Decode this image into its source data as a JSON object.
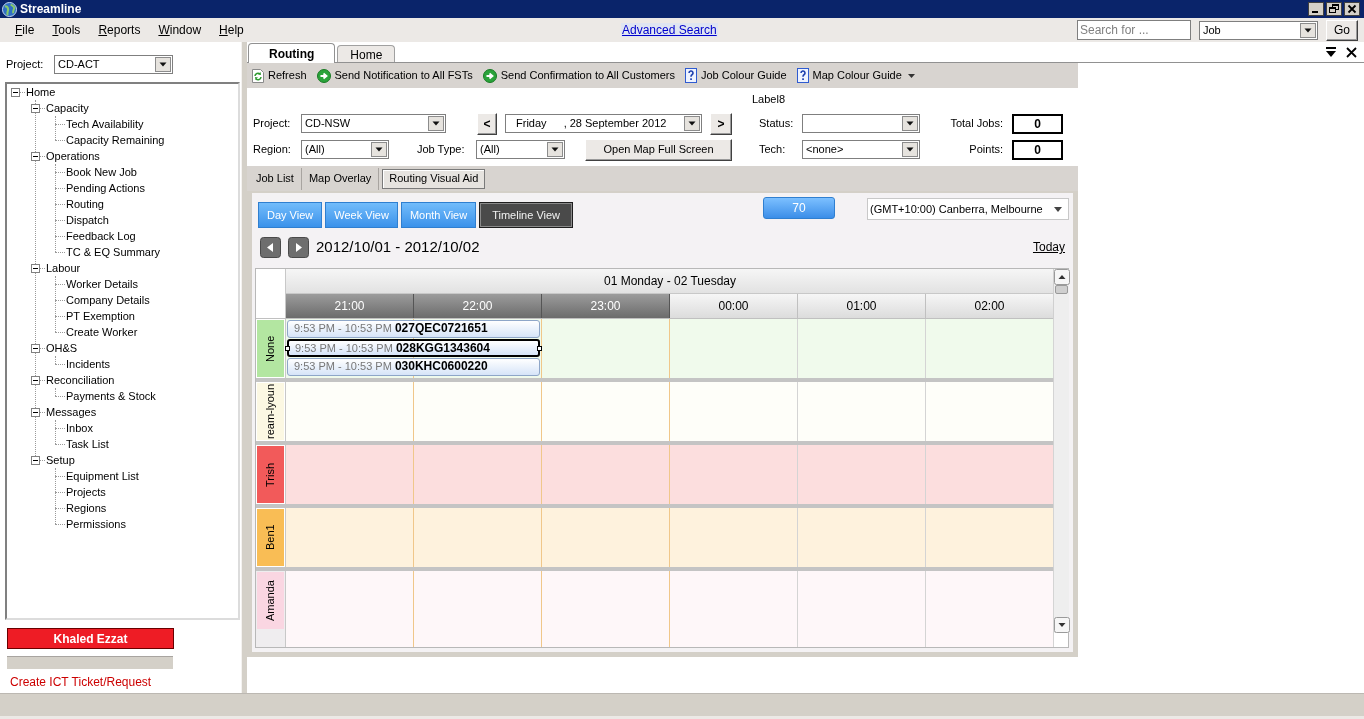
{
  "window": {
    "title": "Streamline"
  },
  "menu": [
    {
      "label": "File"
    },
    {
      "label": "Tools"
    },
    {
      "label": "Reports"
    },
    {
      "label": "Window"
    },
    {
      "label": "Help"
    }
  ],
  "advanced_search": {
    "label": "Advanced Search"
  },
  "quick_search": {
    "placeholder": "Search for ...",
    "type": "Job",
    "button": "Go"
  },
  "sidebar": {
    "project_label": "Project:",
    "project": "CD-ACT",
    "tree": [
      {
        "label": "Home",
        "expanded": true,
        "children": [
          {
            "label": "Capacity",
            "expanded": true,
            "children": [
              {
                "label": "Tech Availability"
              },
              {
                "label": "Capacity Remaining"
              }
            ]
          },
          {
            "label": "Operations",
            "expanded": true,
            "children": [
              {
                "label": "Book New Job"
              },
              {
                "label": "Pending Actions"
              },
              {
                "label": "Routing"
              },
              {
                "label": "Dispatch"
              },
              {
                "label": "Feedback Log"
              },
              {
                "label": "TC & EQ Summary"
              }
            ]
          },
          {
            "label": "Labour",
            "expanded": true,
            "children": [
              {
                "label": "Worker Details"
              },
              {
                "label": "Company Details"
              },
              {
                "label": "PT Exemption"
              },
              {
                "label": "Create Worker"
              }
            ]
          },
          {
            "label": "OH&S",
            "expanded": true,
            "children": [
              {
                "label": "Incidents"
              }
            ]
          },
          {
            "label": "Reconciliation",
            "expanded": true,
            "children": [
              {
                "label": "Payments & Stock"
              }
            ]
          },
          {
            "label": "Messages",
            "expanded": true,
            "children": [
              {
                "label": "Inbox"
              },
              {
                "label": "Task List"
              }
            ]
          },
          {
            "label": "Setup",
            "expanded": true,
            "children": [
              {
                "label": "Equipment List"
              },
              {
                "label": "Projects"
              },
              {
                "label": "Regions"
              },
              {
                "label": "Permissions"
              }
            ]
          }
        ]
      }
    ],
    "user": "Khaled Ezzat",
    "link": "Create ICT Ticket/Request"
  },
  "tabs": [
    {
      "label": "Routing",
      "selected": true
    },
    {
      "label": "Home",
      "selected": false
    }
  ],
  "toolbar": [
    {
      "kind": "refresh",
      "label": "Refresh"
    },
    {
      "kind": "send",
      "label": "Send Notification to All FSTs"
    },
    {
      "kind": "send",
      "label": "Send Confirmation to All Customers"
    },
    {
      "kind": "help",
      "label": "Job Colour Guide"
    },
    {
      "kind": "help",
      "label": "Map Colour Guide",
      "dropdown": true
    }
  ],
  "filters": {
    "caption": "Label8",
    "project": {
      "label": "Project:",
      "value": "CD-NSW"
    },
    "prev": "<",
    "date": {
      "weekday": "Friday",
      "date": ", 28 September 2012"
    },
    "next": ">",
    "status": {
      "label": "Status:"
    },
    "total_jobs": {
      "label": "Total Jobs:",
      "value": "0"
    },
    "region": {
      "label": "Region:",
      "value": "(All)"
    },
    "job_type": {
      "label": "Job Type:",
      "value": "(All)"
    },
    "open_map": "Open Map Full Screen",
    "tech": {
      "label": "Tech:",
      "value": "<none>"
    },
    "points": {
      "label": "Points:",
      "value": "0"
    }
  },
  "view_tabs": [
    {
      "label": "Job List",
      "selected": false
    },
    {
      "label": "Map Overlay",
      "selected": false
    },
    {
      "label": "Routing Visual Aid",
      "selected": true
    }
  ],
  "scheduler": {
    "views": [
      {
        "label": "Day View",
        "selected": false
      },
      {
        "label": "Week View",
        "selected": false
      },
      {
        "label": "Month View",
        "selected": false
      },
      {
        "label": "Timeline View",
        "selected": true
      }
    ],
    "scale": "70",
    "timezone": "(GMT+10:00) Canberra, Melbourne",
    "range": "2012/10/01 - 2012/10/02",
    "today": "Today",
    "day_header": "01 Monday - 02 Tuesday",
    "hours": [
      {
        "label": "21:00",
        "shaded": true
      },
      {
        "label": "22:00",
        "shaded": true
      },
      {
        "label": "23:00",
        "shaded": true
      },
      {
        "label": "00:00",
        "shaded": false
      },
      {
        "label": "01:00",
        "shaded": false
      },
      {
        "label": "02:00",
        "shaded": false
      }
    ],
    "resources": [
      {
        "name": "None",
        "color": "#b3e6a1",
        "events": [
          {
            "time": "9:53 PM - 10:53 PM",
            "title": "027QEC0721651",
            "selected": false
          },
          {
            "time": "9:53 PM - 10:53 PM",
            "title": "028KGG1343604",
            "selected": true
          },
          {
            "time": "9:53 PM - 10:53 PM",
            "title": "030KHC0600220",
            "selected": false
          }
        ]
      },
      {
        "name": "ream-lyoun",
        "color": "#fcf8e3"
      },
      {
        "name": "Trish",
        "color": "#f25a5a"
      },
      {
        "name": "Ben1",
        "color": "#f9bd55"
      },
      {
        "name": "Amanda",
        "color": "#fad6e2"
      }
    ]
  }
}
